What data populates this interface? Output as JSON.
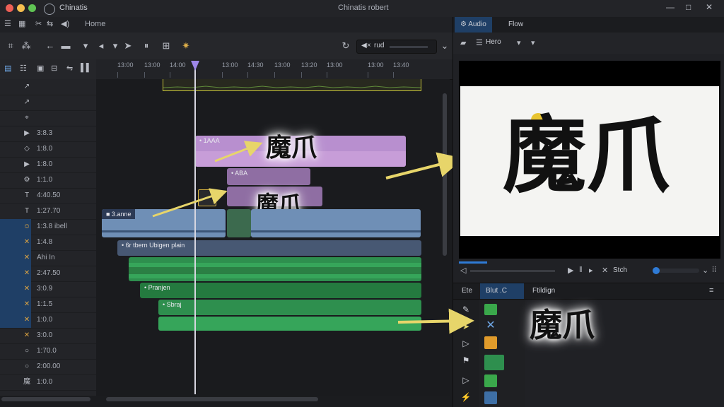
{
  "window": {
    "app_title": "Chinatis",
    "doc_title": "Chinatis robert"
  },
  "menubar": {
    "home_label": "Home"
  },
  "toolbar": {
    "dropdown_value": "rud"
  },
  "ruler": {
    "labels": [
      "13:00",
      "13:00",
      "14:00",
      "13:00",
      "14:30",
      "13:00",
      "13:20",
      "13:00",
      "13:00",
      "13:40"
    ]
  },
  "tracks": {
    "rows": [
      {
        "label": "",
        "icon": "cursor"
      },
      {
        "label": "",
        "icon": "cursor"
      },
      {
        "label": "",
        "icon": "mark"
      },
      {
        "label": "3:8.3",
        "icon": "play"
      },
      {
        "label": "1:8.0",
        "icon": "shape"
      },
      {
        "label": "1:8.0",
        "icon": "play"
      },
      {
        "label": "1:1.0",
        "icon": "gear"
      },
      {
        "label": "4:40.50",
        "icon": "text"
      },
      {
        "label": "1:27.70",
        "icon": "text"
      },
      {
        "label": "1:3.8 ibell",
        "icon": "face"
      },
      {
        "label": "1:4.8",
        "icon": "x"
      },
      {
        "label": "Ahi In",
        "icon": "x"
      },
      {
        "label": "2:47.50",
        "icon": "x"
      },
      {
        "label": "3:0.9",
        "icon": "x"
      },
      {
        "label": "1:1.5",
        "icon": "x"
      },
      {
        "label": "1:0.0",
        "icon": "x"
      },
      {
        "label": "3:0.0",
        "icon": "x"
      },
      {
        "label": "1:70.0",
        "icon": "o"
      },
      {
        "label": "2:00.00",
        "icon": "o"
      },
      {
        "label": "1:0.0",
        "icon": "char"
      }
    ]
  },
  "clips": {
    "title1_label": "• 1AAA",
    "title1_text": "魔爪",
    "title2_label": "• ABA",
    "title3_text": "魔爪",
    "video_label": "■ 3.anne",
    "audio1_label": "• 6r tbern Ubigen plain",
    "audio2_label": "",
    "audio3_label": "• Pranjen",
    "audio4_label": "• Sbraj",
    "audio5_label": ""
  },
  "right_panel": {
    "tabs": [
      "Audio",
      "Flow"
    ],
    "sub_toolbar_label": "Hero",
    "preview_text": "魔爪",
    "playback": {
      "stop_label": "Stch"
    },
    "library_tabs": [
      "Ete",
      "Blut .C",
      "Ftildign"
    ],
    "library_text": "魔爪"
  },
  "colors": {
    "accent_blue": "#1f3f66",
    "title_clip": "#b88fcf",
    "video_clip": "#6f8fb6",
    "audio_clip": "#2e8f4e",
    "playhead": "#9d86e8",
    "highlight_yellow": "#e7d56a"
  }
}
